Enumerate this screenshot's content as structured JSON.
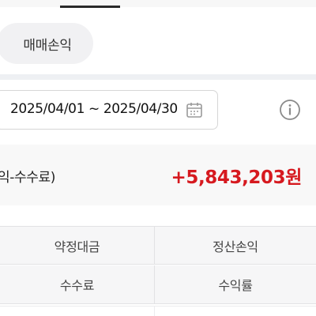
{
  "chip": {
    "label": "매매손익"
  },
  "date_filter": {
    "range": "2025/04/01 ~ 2025/04/30"
  },
  "summary": {
    "label": "익-수수료)",
    "value": "+5,843,203원",
    "value_color": "#d6191f"
  },
  "table": {
    "rows": [
      {
        "left": "약정대금",
        "right": "정산손익"
      },
      {
        "left": "수수료",
        "right": "수익률"
      }
    ]
  },
  "icons": {
    "calendar": "calendar-icon",
    "info": "info-icon"
  }
}
